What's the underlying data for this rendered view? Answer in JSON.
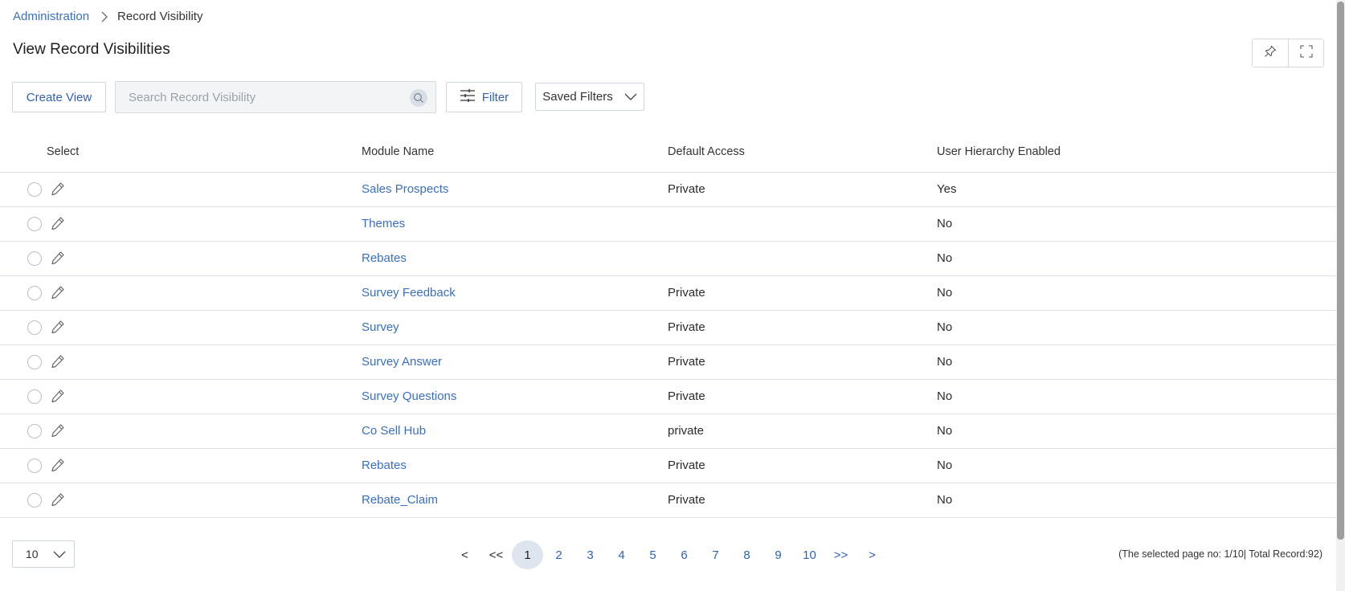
{
  "breadcrumb": {
    "parent": "Administration",
    "current": "Record Visibility"
  },
  "page_title": "View Record Visibilities",
  "toolbar": {
    "create_label": "Create View",
    "search_placeholder": "Search Record Visibility",
    "filter_label": "Filter",
    "saved_filters_label": "Saved Filters"
  },
  "table": {
    "headers": {
      "select": "Select",
      "module": "Module Name",
      "access": "Default Access",
      "hierarchy": "User Hierarchy Enabled"
    },
    "rows": [
      {
        "module": "Sales Prospects",
        "access": "Private",
        "hierarchy": "Yes"
      },
      {
        "module": "Themes",
        "access": "",
        "hierarchy": "No"
      },
      {
        "module": "Rebates",
        "access": "",
        "hierarchy": "No"
      },
      {
        "module": "Survey Feedback",
        "access": "Private",
        "hierarchy": "No"
      },
      {
        "module": "Survey",
        "access": "Private",
        "hierarchy": "No"
      },
      {
        "module": "Survey Answer",
        "access": "Private",
        "hierarchy": "No"
      },
      {
        "module": "Survey Questions",
        "access": "Private",
        "hierarchy": "No"
      },
      {
        "module": "Co Sell Hub",
        "access": "private",
        "hierarchy": "No"
      },
      {
        "module": "Rebates",
        "access": "Private",
        "hierarchy": "No"
      },
      {
        "module": "Rebate_Claim",
        "access": "Private",
        "hierarchy": "No"
      }
    ]
  },
  "pagination": {
    "page_size": "10",
    "prev": "<",
    "first": "<<",
    "pages": [
      "1",
      "2",
      "3",
      "4",
      "5",
      "6",
      "7",
      "8",
      "9",
      "10"
    ],
    "active_page": "1",
    "last": ">>",
    "next": ">",
    "info": "(The selected page no: 1/10| Total Record:92)"
  },
  "colors": {
    "link": "#3a6fc4",
    "active_page_bg": "#dfe5ee"
  }
}
